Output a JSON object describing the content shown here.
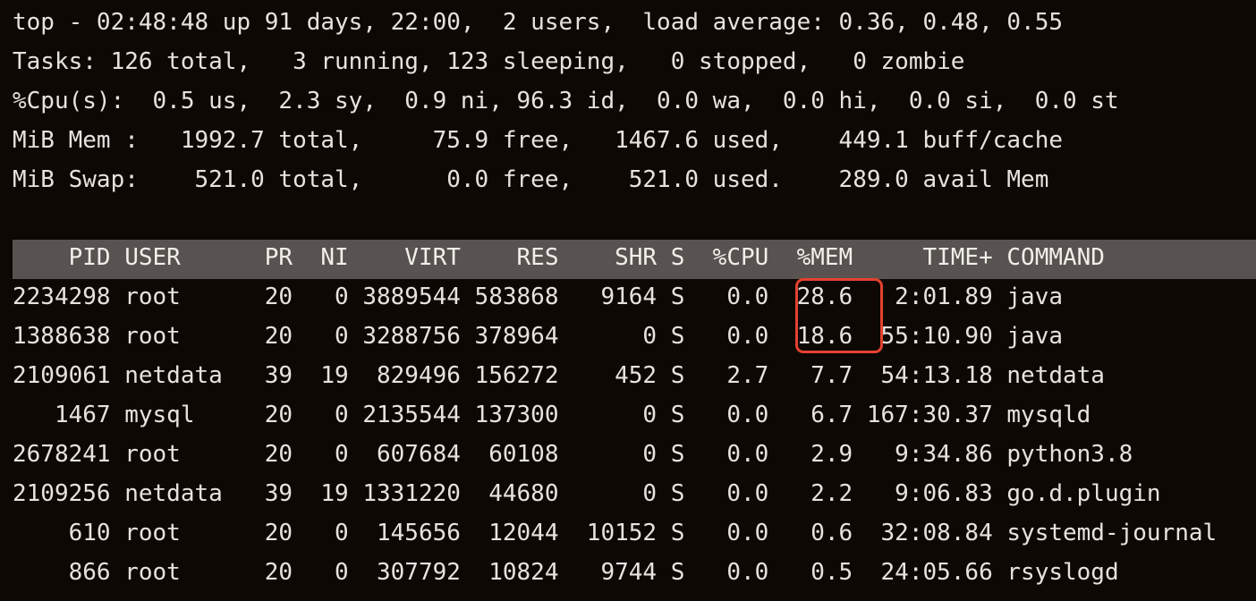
{
  "summary": {
    "line1": "top - 02:48:48 up 91 days, 22:00,  2 users,  load average: 0.36, 0.48, 0.55",
    "line2": "Tasks: 126 total,   3 running, 123 sleeping,   0 stopped,   0 zombie",
    "line3": "%Cpu(s):  0.5 us,  2.3 sy,  0.9 ni, 96.3 id,  0.0 wa,  0.0 hi,  0.0 si,  0.0 st",
    "line4": "MiB Mem :   1992.7 total,     75.9 free,   1467.6 used,    449.1 buff/cache",
    "line5": "MiB Swap:    521.0 total,      0.0 free,    521.0 used.    289.0 avail Mem"
  },
  "process_table": {
    "header": "    PID USER      PR  NI    VIRT    RES    SHR S  %CPU  %MEM     TIME+ COMMAND",
    "rows": [
      "2234298 root      20   0 3889544 583868   9164 S   0.0  28.6   2:01.89 java",
      "1388638 root      20   0 3288756 378964      0 S   0.0  18.6  55:10.90 java",
      "2109061 netdata   39  19  829496 156272    452 S   2.7   7.7  54:13.18 netdata",
      "   1467 mysql     20   0 2135544 137300      0 S   0.0   6.7 167:30.37 mysqld",
      "2678241 root      20   0  607684  60108      0 S   0.0   2.9   9:34.86 python3.8",
      "2109256 netdata   39  19 1331220  44680      0 S   0.0   2.2   9:06.83 go.d.plugin",
      "    610 root      20   0  145656  12044  10152 S   0.0   0.6  32:08.84 systemd-journal",
      "    866 root      20   0  307792  10824   9744 S   0.0   0.5  24:05.66 rsyslogd"
    ]
  },
  "colors": {
    "background": "#0e0805",
    "text": "#e6e3df",
    "header_bar": "#585350",
    "highlight_border": "#e5412f"
  }
}
